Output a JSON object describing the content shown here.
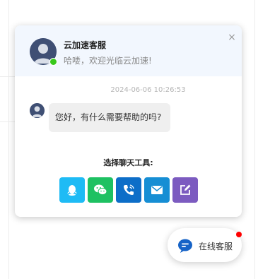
{
  "agent": {
    "name": "云加速客服",
    "greeting": "哈喽，欢迎光临云加速!",
    "status": "online",
    "status_color": "#38c81b"
  },
  "header": {
    "close_symbol": "×"
  },
  "chat": {
    "timestamp": "2024-06-06 10:26:53",
    "messages": [
      {
        "sender": "agent",
        "text": "您好，有什么需要帮助的吗?"
      }
    ]
  },
  "tools": {
    "title": "选择聊天工具:",
    "items": [
      {
        "name": "qq",
        "icon": "qq-icon",
        "color": "#1ebbf5"
      },
      {
        "name": "wechat",
        "icon": "wechat-icon",
        "color": "#1ec162"
      },
      {
        "name": "phone",
        "icon": "phone-icon",
        "color": "#0d6ec8"
      },
      {
        "name": "email",
        "icon": "mail-icon",
        "color": "#168ed4"
      },
      {
        "name": "message",
        "icon": "edit-icon",
        "color": "#7c5bc0"
      }
    ]
  },
  "float_button": {
    "label": "在线客服",
    "icon": "chat-bubble-icon",
    "icon_color": "#1663c7",
    "notification_color": "#ff0000"
  }
}
